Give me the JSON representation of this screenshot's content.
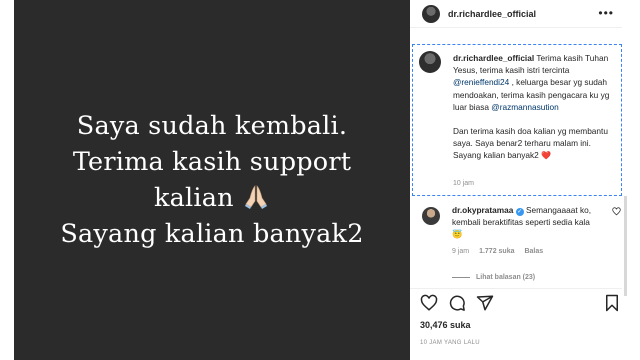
{
  "post_image": {
    "lines": [
      "Saya sudah kembali.",
      "Terima kasih support",
      "kalian",
      "Sayang kalian banyak2"
    ]
  },
  "header": {
    "username": "dr.richardlee_official",
    "more_icon": "more-horizontal-icon"
  },
  "caption": {
    "username": "dr.richardlee_official",
    "text_a": "Terima kasih Tuhan Yesus, terima kasih istri tercinta",
    "mention_1": "@renieffendi24",
    "text_b": ", keluarga besar yg sudah mendoakan, terima kasih pengacara ku yg luar biasa",
    "mention_2": "@razmannasution",
    "text_c": "Dan terima kasih doa kalian yg membantu saya. Saya benar2 terharu malam ini. Sayang kalian banyak2",
    "heart": "❤️",
    "time": "10 jam"
  },
  "comment": {
    "username": "dr.okypratamaa",
    "text": "Semangaaaat ko, kembali beraktifitas seperti sedia kala",
    "emoji": "😇",
    "time": "9 jam",
    "likes": "1.772 suka",
    "reply": "Balas",
    "view_replies": "Lihat balasan (23)"
  },
  "actions": {
    "like_icon": "heart-icon",
    "comment_icon": "comment-icon",
    "share_icon": "share-icon",
    "save_icon": "bookmark-icon"
  },
  "likes": "30,476 suka",
  "posted_ago": "10 JAM YANG LALU",
  "colors": {
    "image_bg": "#2b2b2b",
    "mention": "#00376b",
    "heart": "#ed4956",
    "verified": "#3897f0"
  }
}
